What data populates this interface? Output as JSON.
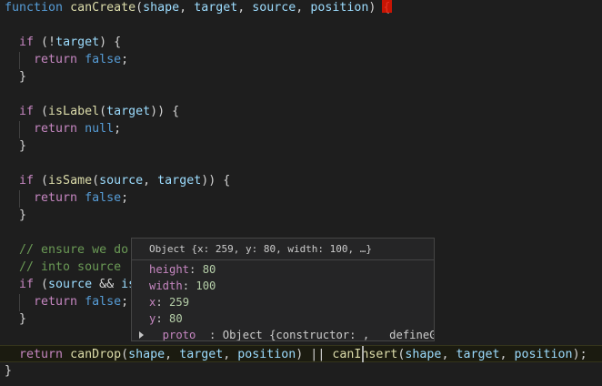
{
  "editor": {
    "lines": [
      {
        "tokens": [
          [
            "kw",
            "function"
          ],
          [
            "punc",
            " "
          ],
          [
            "fn",
            "canCreate"
          ],
          [
            "punc",
            "("
          ],
          [
            "param",
            "shape"
          ],
          [
            "punc",
            ", "
          ],
          [
            "param",
            "target"
          ],
          [
            "punc",
            ", "
          ],
          [
            "param",
            "source"
          ],
          [
            "punc",
            ", "
          ],
          [
            "param",
            "position"
          ],
          [
            "punc",
            ") {"
          ]
        ]
      },
      {
        "tokens": []
      },
      {
        "tokens": [
          [
            "punc",
            "  "
          ],
          [
            "ctrl",
            "if"
          ],
          [
            "punc",
            " (!"
          ],
          [
            "param",
            "target"
          ],
          [
            "punc",
            ") {"
          ]
        ]
      },
      {
        "tokens": [
          [
            "punc",
            "    "
          ],
          [
            "ctrl",
            "return"
          ],
          [
            "punc",
            " "
          ],
          [
            "lit",
            "false"
          ],
          [
            "punc",
            ";"
          ]
        ]
      },
      {
        "tokens": [
          [
            "punc",
            "  }"
          ]
        ]
      },
      {
        "tokens": []
      },
      {
        "tokens": [
          [
            "punc",
            "  "
          ],
          [
            "ctrl",
            "if"
          ],
          [
            "punc",
            " ("
          ],
          [
            "fn",
            "isLabel"
          ],
          [
            "punc",
            "("
          ],
          [
            "param",
            "target"
          ],
          [
            "punc",
            ")) {"
          ]
        ]
      },
      {
        "tokens": [
          [
            "punc",
            "    "
          ],
          [
            "ctrl",
            "return"
          ],
          [
            "punc",
            " "
          ],
          [
            "lit",
            "null"
          ],
          [
            "punc",
            ";"
          ]
        ]
      },
      {
        "tokens": [
          [
            "punc",
            "  }"
          ]
        ]
      },
      {
        "tokens": []
      },
      {
        "tokens": [
          [
            "punc",
            "  "
          ],
          [
            "ctrl",
            "if"
          ],
          [
            "punc",
            " ("
          ],
          [
            "fn",
            "isSame"
          ],
          [
            "punc",
            "("
          ],
          [
            "param",
            "source"
          ],
          [
            "punc",
            ", "
          ],
          [
            "param",
            "target"
          ],
          [
            "punc",
            ")) {"
          ]
        ]
      },
      {
        "tokens": [
          [
            "punc",
            "    "
          ],
          [
            "ctrl",
            "return"
          ],
          [
            "punc",
            " "
          ],
          [
            "lit",
            "false"
          ],
          [
            "punc",
            ";"
          ]
        ]
      },
      {
        "tokens": [
          [
            "punc",
            "  }"
          ]
        ]
      },
      {
        "tokens": []
      },
      {
        "tokens": [
          [
            "punc",
            "  "
          ],
          [
            "cmt",
            "// ensure we do"
          ]
        ]
      },
      {
        "tokens": [
          [
            "punc",
            "  "
          ],
          [
            "cmt",
            "// into source"
          ]
        ]
      },
      {
        "tokens": [
          [
            "punc",
            "  "
          ],
          [
            "ctrl",
            "if"
          ],
          [
            "punc",
            " ("
          ],
          [
            "param",
            "source"
          ],
          [
            "punc",
            " && "
          ],
          [
            "param",
            "is"
          ]
        ]
      },
      {
        "tokens": [
          [
            "punc",
            "    "
          ],
          [
            "ctrl",
            "return"
          ],
          [
            "punc",
            " "
          ],
          [
            "lit",
            "false"
          ],
          [
            "punc",
            ";"
          ]
        ]
      },
      {
        "tokens": [
          [
            "punc",
            "  }"
          ]
        ]
      },
      {
        "tokens": []
      },
      {
        "tokens": [
          [
            "punc",
            "  "
          ],
          [
            "ctrl",
            "return"
          ],
          [
            "punc",
            " "
          ],
          [
            "fn",
            "canDrop"
          ],
          [
            "punc",
            "("
          ],
          [
            "param",
            "shape"
          ],
          [
            "punc",
            ", "
          ],
          [
            "param",
            "target"
          ],
          [
            "punc",
            ", "
          ],
          [
            "param",
            "position"
          ],
          [
            "punc",
            ") || "
          ],
          [
            "fn",
            "canInsert"
          ],
          [
            "punc",
            "("
          ],
          [
            "param",
            "shape"
          ],
          [
            "punc",
            ", "
          ],
          [
            "param",
            "target"
          ],
          [
            "punc",
            ", "
          ],
          [
            "param",
            "position"
          ],
          [
            "punc",
            ");"
          ]
        ]
      },
      {
        "tokens": [
          [
            "punc",
            "}"
          ]
        ]
      }
    ],
    "current_line": 20
  },
  "hover": {
    "header": "Object {x: 259, y: 80, width: 100, …}",
    "properties": [
      {
        "key": "height",
        "value": "80"
      },
      {
        "key": "width",
        "value": "100"
      },
      {
        "key": "x",
        "value": "259"
      },
      {
        "key": "y",
        "value": "80"
      }
    ],
    "proto": {
      "key": "__proto__",
      "value": "Object {constructor: , __defineGe"
    }
  },
  "colors": {
    "background": "#1e1e1e",
    "keyword": "#569cd6",
    "control": "#c586c0",
    "function": "#dcdcaa",
    "parameter": "#9cdcfe",
    "comment": "#6a9955",
    "number": "#b5cea8",
    "bracket_error": "#e51400"
  }
}
